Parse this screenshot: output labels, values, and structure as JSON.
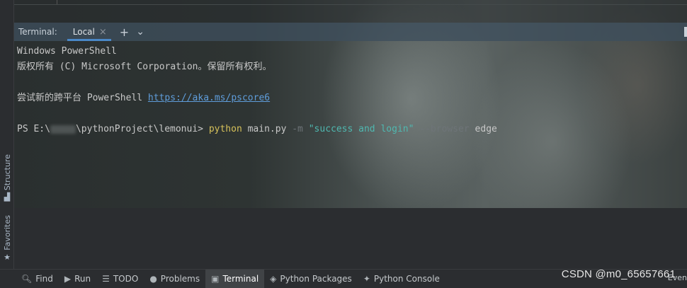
{
  "terminal": {
    "title": "Terminal:",
    "tab_label": "Local",
    "tab_close": "×",
    "add_button": "+",
    "dropdown_button": "⌄",
    "lines": {
      "l1": "Windows PowerShell",
      "l2": "版权所有 (C) Microsoft Corporation。保留所有权利。",
      "l3_prefix": "尝试新的跨平台 PowerShell ",
      "l3_link": "https://aka.ms/pscore6",
      "prompt_start": "PS E:\\",
      "prompt_end": "\\pythonProject\\lemonui> ",
      "cmd_python": "python",
      "cmd_script": " main.py ",
      "opt_m": "-m",
      "arg_str": " \"success and login\" ",
      "opt_browser": "--browser",
      "arg_edge": " edge"
    }
  },
  "side_tabs": {
    "structure": "Structure",
    "favorites": "Favorites"
  },
  "bottom_bar": {
    "find": "Find",
    "run": "Run",
    "todo": "TODO",
    "problems": "Problems",
    "terminal": "Terminal",
    "python_packages": "Python Packages",
    "python_console": "Python Console",
    "event_partial": "Even"
  },
  "watermark": "CSDN @m0_65657661",
  "colors": {
    "link": "#5f9ddb",
    "command": "#d6c15a",
    "string": "#4fb8b0",
    "option": "#6e7478",
    "tab_underline": "#4a88c7"
  }
}
